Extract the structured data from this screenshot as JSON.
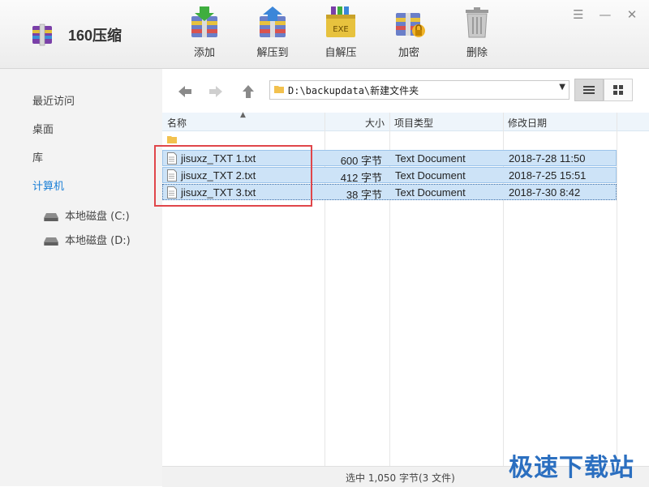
{
  "app": {
    "title": "160压缩"
  },
  "toolbar": {
    "add": "添加",
    "extract_to": "解压到",
    "self_extract": "自解压",
    "self_extract_badge": "EXE",
    "encrypt": "加密",
    "delete": "删除"
  },
  "window_controls": {
    "menu": "☰",
    "minimize": "—",
    "close": "✕"
  },
  "sidebar": {
    "recent": "最近访问",
    "desktop": "桌面",
    "library": "库",
    "computer": "计算机",
    "drives": [
      {
        "label": "本地磁盘 (C:)"
      },
      {
        "label": "本地磁盘 (D:)"
      }
    ]
  },
  "path": {
    "value": "D:\\backupdata\\新建文件夹"
  },
  "columns": {
    "name": "名称",
    "size": "大小",
    "type": "项目类型",
    "modified": "修改日期"
  },
  "files": [
    {
      "name": "jisuxz_TXT 1.txt",
      "size": "600 字节",
      "type": "Text Document",
      "modified": "2018-7-28 11:50"
    },
    {
      "name": "jisuxz_TXT 2.txt",
      "size": "412 字节",
      "type": "Text Document",
      "modified": "2018-7-25 15:51"
    },
    {
      "name": "jisuxz_TXT 3.txt",
      "size": "38 字节",
      "type": "Text Document",
      "modified": "2018-7-30 8:42"
    }
  ],
  "status": {
    "text": "选中 1,050 字节(3 文件)"
  },
  "watermark": {
    "text": "极速下载站"
  },
  "colors": {
    "accent": "#1a7fd6",
    "selection": "#cde3f7",
    "highlight": "#e0464a"
  }
}
